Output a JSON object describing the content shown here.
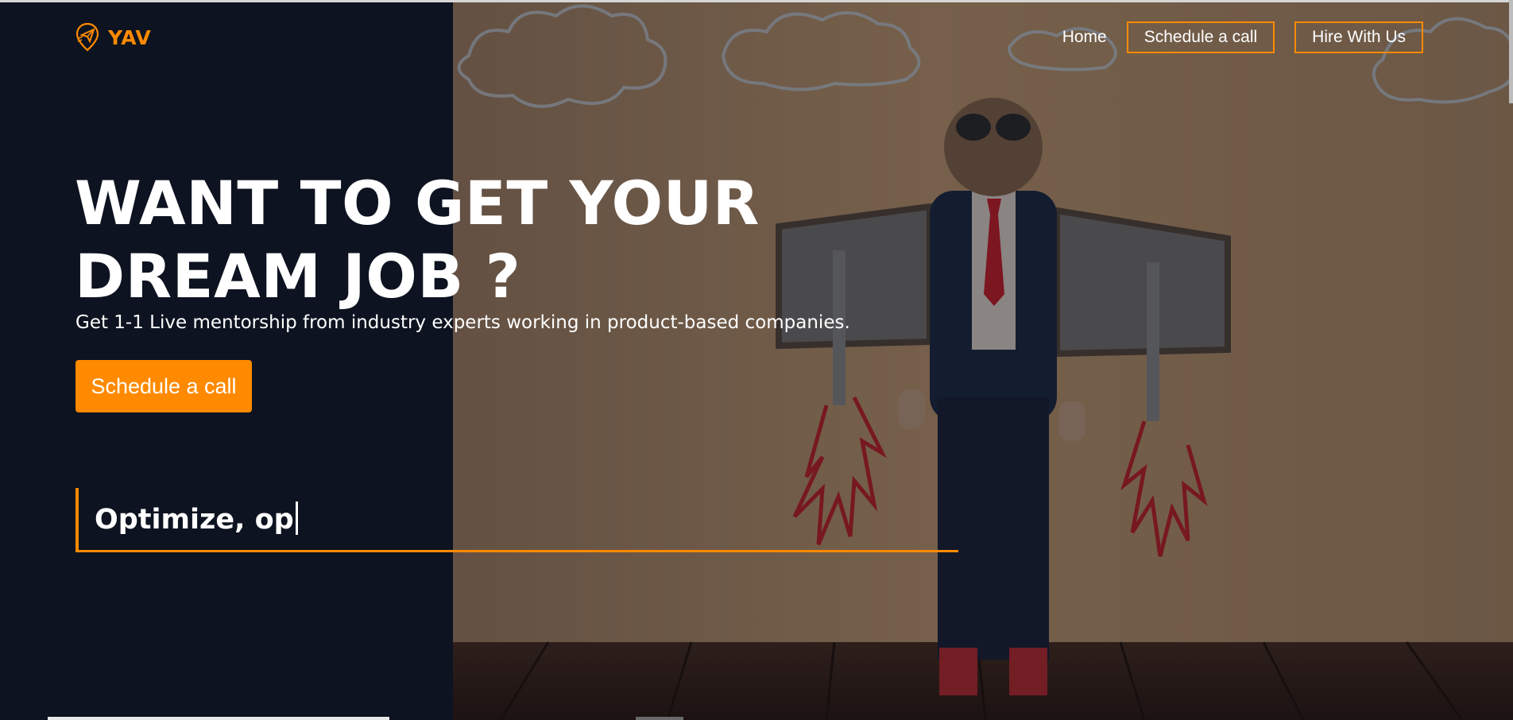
{
  "brand": {
    "name": "YAV",
    "accent_color": "#ff8a00",
    "logo_icon": "paper-plane-pin-icon"
  },
  "nav": {
    "home_label": "Home",
    "schedule_label": "Schedule a call",
    "hire_label": "Hire With Us"
  },
  "hero": {
    "headline": "WANT TO GET YOUR DREAM JOB ?",
    "subheadline": "Get 1-1 Live mentorship from industry experts working in product-based companies.",
    "cta_label": "Schedule a call",
    "typing_text": "Optimize, op",
    "background_image": "boy-with-cardboard-jetpack-photo"
  },
  "colors": {
    "background": "#0d1320",
    "text": "#ffffff"
  }
}
